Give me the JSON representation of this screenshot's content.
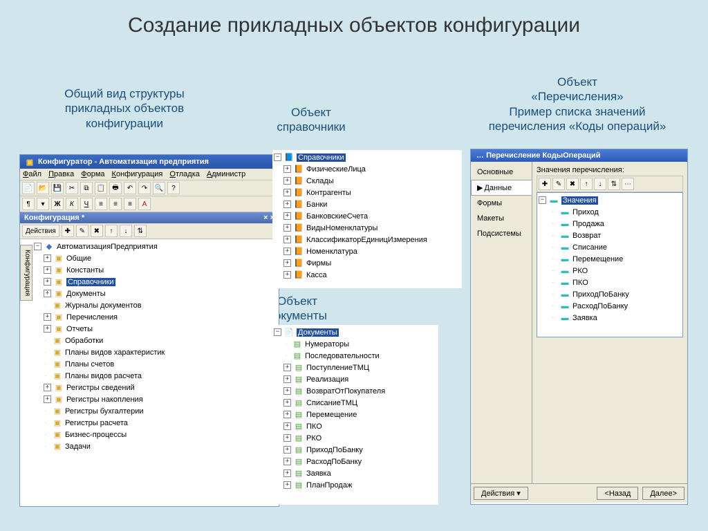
{
  "slide_title": "Создание прикладных объектов конфигурации",
  "captions": {
    "a": "Общий вид структуры\nприкладных объектов\nконфигурации",
    "b": "Объект\nсправочники",
    "c": "Объект\nдокументы",
    "d": "Объект\n«Перечисления»\nПример списка значений\nперечисления «Коды операций»"
  },
  "panelA": {
    "title": "Конфигуратор - Автоматизация предприятия",
    "menu": [
      "Файл",
      "Правка",
      "Форма",
      "Конфигурация",
      "Отладка",
      "Администр"
    ],
    "subtitle": "Конфигурация *",
    "vert_tab": "Конфигурация",
    "mini_tb_text": "Действия",
    "root": "АвтоматизацияПредприятия",
    "items": [
      {
        "label": "Общие",
        "exp": "+"
      },
      {
        "label": "Константы",
        "exp": "+"
      },
      {
        "label": "Справочники",
        "exp": "+",
        "selected": true
      },
      {
        "label": "Документы",
        "exp": "+"
      },
      {
        "label": "Журналы документов",
        "exp": ""
      },
      {
        "label": "Перечисления",
        "exp": "+"
      },
      {
        "label": "Отчеты",
        "exp": "+"
      },
      {
        "label": "Обработки",
        "exp": ""
      },
      {
        "label": "Планы видов характеристик",
        "exp": ""
      },
      {
        "label": "Планы счетов",
        "exp": ""
      },
      {
        "label": "Планы видов расчета",
        "exp": ""
      },
      {
        "label": "Регистры сведений",
        "exp": "+"
      },
      {
        "label": "Регистры накопления",
        "exp": "+"
      },
      {
        "label": "Регистры бухгалтерии",
        "exp": ""
      },
      {
        "label": "Регистры расчета",
        "exp": ""
      },
      {
        "label": "Бизнес-процессы",
        "exp": ""
      },
      {
        "label": "Задачи",
        "exp": ""
      }
    ]
  },
  "panelB": {
    "root": "Справочники",
    "items": [
      "ФизическиеЛица",
      "Склады",
      "Контрагенты",
      "Банки",
      "БанковскиеСчета",
      "ВидыНоменклатуры",
      "КлассификаторЕдиницИзмерения",
      "Номенклатура",
      "Фирмы",
      "Касса"
    ]
  },
  "panelC": {
    "root": "Документы",
    "items": [
      "Нумераторы",
      "Последовательности",
      "ПоступлениеТМЦ",
      "Реализация",
      "ВозвратОтПокупателя",
      "СписаниеТМЦ",
      "Перемещение",
      "ПКО",
      "РКО",
      "ПриходПоБанку",
      "РасходПоБанку",
      "Заявка",
      "ПланПродаж"
    ]
  },
  "panelD": {
    "title": "Перечисление КодыОпераций",
    "tabs": [
      "Основные",
      "Данные",
      "Формы",
      "Макеты",
      "Подсистемы"
    ],
    "active_tab": 1,
    "field_label": "Значения перечисления:",
    "root": "Значения",
    "values": [
      "Приход",
      "Продажа",
      "Возврат",
      "Списание",
      "Перемещение",
      "РКО",
      "ПКО",
      "ПриходПоБанку",
      "РасходПоБанку",
      "Заявка"
    ],
    "buttons": {
      "actions": "Действия",
      "prev": "<Назад",
      "next": "Далее>"
    }
  }
}
